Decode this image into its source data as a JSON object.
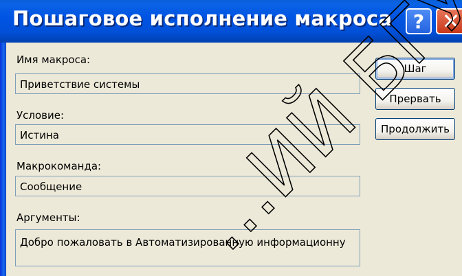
{
  "window": {
    "title": "Пошаговое исполнение макроса",
    "help_label": "?",
    "close_label": "✕"
  },
  "fields": {
    "macro_name": {
      "label": "Имя макроса:",
      "value": "Приветствие системы"
    },
    "condition": {
      "label": "Условие:",
      "value": "Истина"
    },
    "action": {
      "label": "Макрокоманда:",
      "value": "Сообщение"
    },
    "arguments": {
      "label": "Аргументы:",
      "value": "Добро пожаловать в Автоматизированную информационну"
    }
  },
  "buttons": {
    "step": "Шаг",
    "halt": "Прервать",
    "continue": "Продолжить"
  },
  "watermark": {
    "text": "…ИЙ БГУИР",
    "color": "#000000"
  },
  "colors": {
    "titlebar": "#0054e3",
    "dialog_bg": "#ece9d8",
    "field_border": "#7f9db9",
    "close_button": "#c9391a"
  }
}
